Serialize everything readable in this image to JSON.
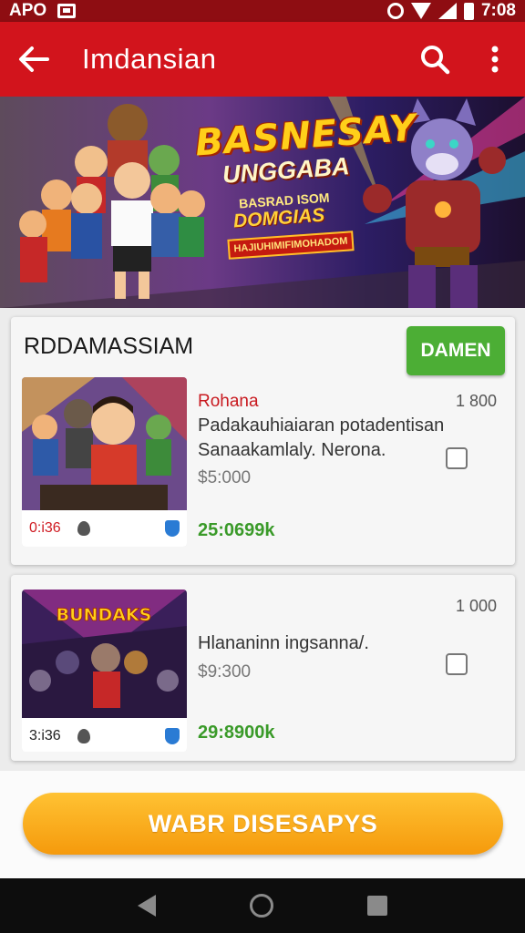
{
  "status_bar": {
    "carrier": "APO",
    "time": "7:08"
  },
  "app_bar": {
    "title": "Imdansian"
  },
  "banner": {
    "title": "BASNESAY",
    "subtitle": "UNGGABA",
    "tagline": "BASRAD ISOM",
    "tagline2": "DOMGIAS",
    "strip": "HAJIUHIMIFIMOHADOM"
  },
  "section": {
    "title": "RDDAMASSIAM",
    "button_label": "DAMEN"
  },
  "items": [
    {
      "subtitle": "Rohana",
      "number": "1 800",
      "description_line1": "Padakauhiaiaran potadentisan",
      "description_line2": "Sanaakamlaly. Nerona.",
      "price": "$5:000",
      "stat": "25:0699k",
      "count": "0:i36"
    },
    {
      "number": "1 000",
      "description_line1": "Hlananinn ingsanna/.",
      "price": "$9:300",
      "stat": "29:8900k",
      "count": "3:i36",
      "thumb_title": "BUNDAKS"
    }
  ],
  "cta": {
    "label": "WABR DISESAPYS"
  },
  "colors": {
    "app_bar": "#d2141c",
    "status_bar": "#8e0d12",
    "accent_green": "#4cae35",
    "cta": "#f7a512"
  }
}
